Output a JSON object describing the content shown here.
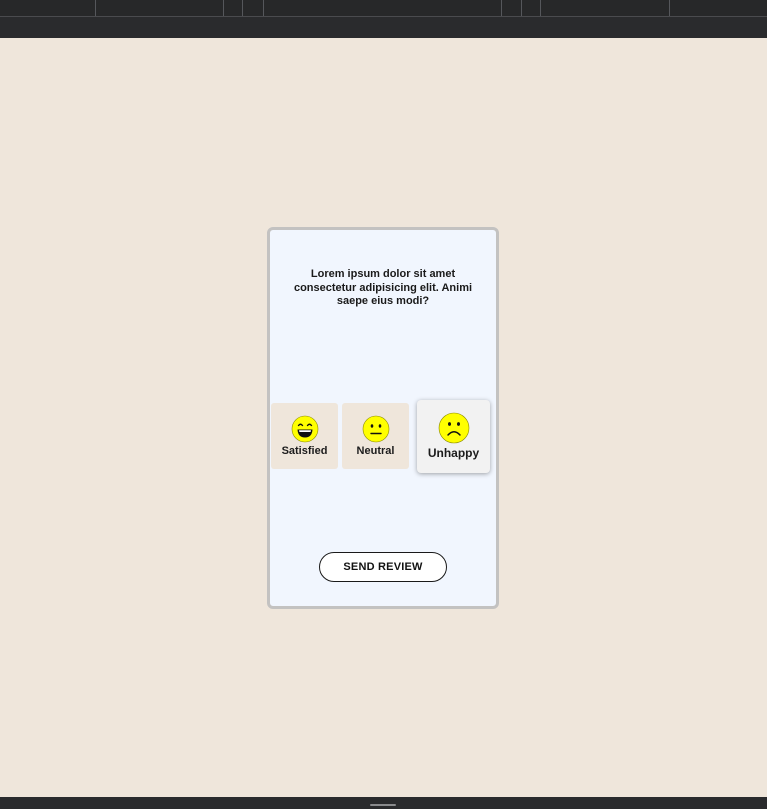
{
  "question": "Lorem ipsum dolor sit amet consectetur adipisicing elit. Animi saepe eius modi?",
  "options": [
    {
      "label": "Satisfied",
      "icon": "grinning-face-icon",
      "selected": false
    },
    {
      "label": "Neutral",
      "icon": "neutral-face-icon",
      "selected": false
    },
    {
      "label": "Unhappy",
      "icon": "frowning-face-icon",
      "selected": true
    }
  ],
  "send_button": {
    "label": "SEND REVIEW"
  },
  "colors": {
    "page_background": "#efe6db",
    "card_background": "#f1f6fe",
    "card_border": "#c3c2c1",
    "emoji_yellow": "#ffff00",
    "selected_option_background": "#f2f2f2",
    "chrome_dark": "#2a2b2d"
  }
}
